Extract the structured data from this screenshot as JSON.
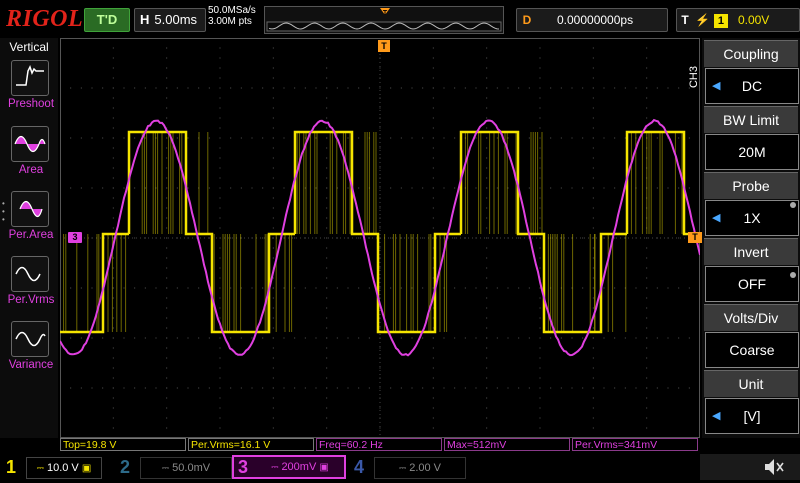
{
  "topbar": {
    "logo": "RIGOL",
    "trigger_status": "T'D",
    "timebase_label": "H",
    "timebase": "5.00ms",
    "sample_rate": "50.0MSa/s",
    "memory_depth": "3.00M pts",
    "delay_label": "D",
    "delay": "0.00000000ps",
    "trigger_label": "T",
    "trigger_source": "1",
    "trigger_level": "0.00V"
  },
  "left_menu": {
    "title": "Vertical",
    "items": [
      {
        "label": "Preshoot",
        "icon": "preshoot-icon"
      },
      {
        "label": "Area",
        "icon": "area-icon"
      },
      {
        "label": "Per.Area",
        "icon": "per-area-icon"
      },
      {
        "label": "Per.Vrms",
        "icon": "per-vrms-icon"
      },
      {
        "label": "Variance",
        "icon": "variance-icon"
      }
    ]
  },
  "right_menu": {
    "channel": "CH3",
    "items": [
      {
        "title": "Coupling",
        "value": "DC",
        "has_arrow": true
      },
      {
        "title": "BW Limit",
        "value": "20M",
        "has_arrow": false
      },
      {
        "title": "Probe",
        "value": "1X",
        "has_arrow": true
      },
      {
        "title": "Invert",
        "value": "OFF",
        "has_arrow": false
      },
      {
        "title": "Volts/Div",
        "value": "Coarse",
        "has_arrow": false
      },
      {
        "title": "Unit",
        "value": "[V]",
        "has_arrow": true
      }
    ]
  },
  "measurements": [
    {
      "text": "Top=19.8 V",
      "color": "#f5e400"
    },
    {
      "text": "Per.Vrms=16.1 V",
      "color": "#f5e400"
    },
    {
      "text": "Freq=60.2 Hz",
      "color": "#e040e0"
    },
    {
      "text": "Max=512mV",
      "color": "#e040e0"
    },
    {
      "text": "Per.Vrms=341mV",
      "color": "#e040e0"
    }
  ],
  "channels": [
    {
      "num": "1",
      "scale": "10.0 V",
      "color": "#f5e400",
      "active": true
    },
    {
      "num": "2",
      "scale": "50.0mV",
      "color": "#2d6b8a",
      "active": false
    },
    {
      "num": "3",
      "scale": "200mV",
      "color": "#e040e0",
      "active": true
    },
    {
      "num": "4",
      "scale": "2.00 V",
      "color": "#3a58a8",
      "active": false
    }
  ],
  "markers": {
    "ch3_offset": "3",
    "trigger_level": "T",
    "trigger_position": "T"
  },
  "colors": {
    "ch1": "#f5e400",
    "ch3": "#e040e0",
    "trigger": "#ff9a1a",
    "grid": "#555555"
  },
  "waveform_summary": {
    "ch3_frequency_hz": 60.2,
    "ch3_max_mv": 512,
    "ch1_top_v": 19.8
  },
  "icons": {
    "speaker": "speaker-muted-icon"
  }
}
